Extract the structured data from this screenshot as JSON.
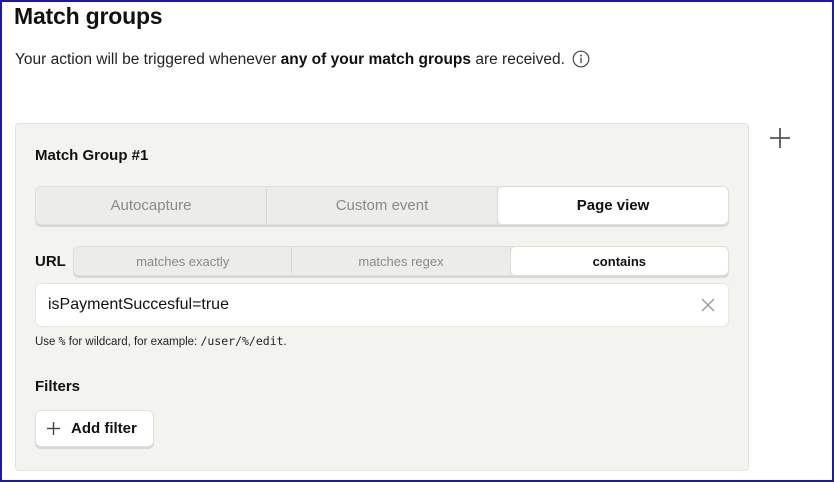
{
  "header": {
    "title": "Match groups",
    "subtitle_prefix": "Your action will be triggered whenever ",
    "subtitle_bold": "any of your match groups",
    "subtitle_suffix": " are received.",
    "info_icon": "info-circle-icon"
  },
  "add_group_icon": "plus-icon",
  "match_group": {
    "title": "Match Group #1",
    "event_types": [
      {
        "label": "Autocapture",
        "active": false
      },
      {
        "label": "Custom event",
        "active": false
      },
      {
        "label": "Page view",
        "active": true
      }
    ],
    "url": {
      "label": "URL",
      "match_modes": [
        {
          "label": "matches exactly",
          "active": false
        },
        {
          "label": "matches regex",
          "active": false
        },
        {
          "label": "contains",
          "active": true
        }
      ],
      "value": "isPaymentSuccesful=true",
      "clear_icon": "close-icon",
      "hint_prefix": "Use ",
      "hint_wildcard": "%",
      "hint_middle": " for wildcard, for example: ",
      "hint_example": "/user/%/edit",
      "hint_suffix": "."
    },
    "filters": {
      "title": "Filters",
      "add_button_label": "Add filter",
      "add_button_icon": "plus-icon"
    }
  },
  "colors": {
    "card_background": "#f3f3f0",
    "segment_background": "#ececea",
    "active_segment": "#ffffff",
    "inactive_text": "#8a8a86",
    "frame_border": "#1a1aa8"
  }
}
